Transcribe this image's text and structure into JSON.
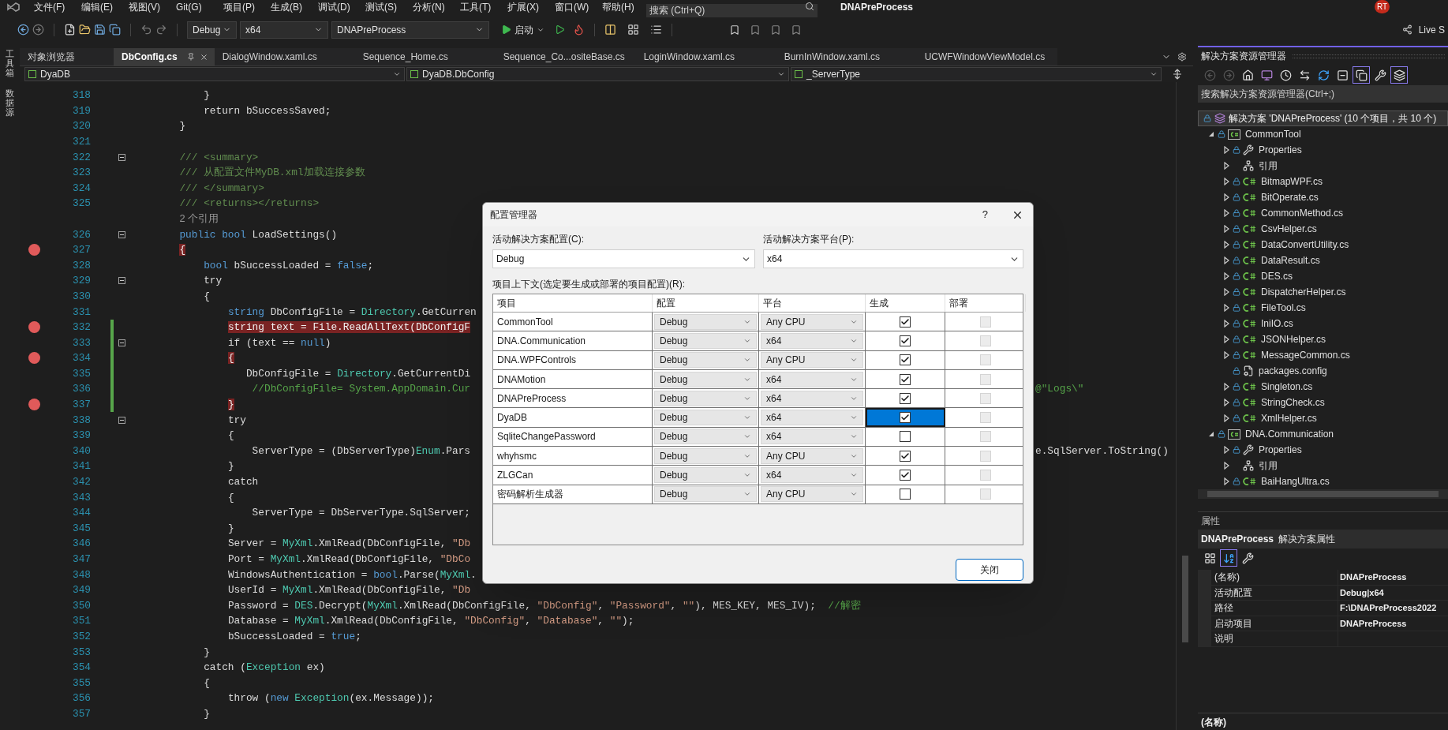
{
  "menu": [
    "文件(F)",
    "编辑(E)",
    "视图(V)",
    "Git(G)",
    "项目(P)",
    "生成(B)",
    "调试(D)",
    "测试(S)",
    "分析(N)",
    "工具(T)",
    "扩展(X)",
    "窗口(W)",
    "帮助(H)"
  ],
  "search": {
    "placeholder": "搜索 (Ctrl+Q)"
  },
  "window_title": "DNAPreProcess",
  "user_badge": "RT",
  "toolbar": {
    "configuration": "Debug",
    "platform": "x64",
    "startup_project": "DNAPreProcess",
    "start_button": "启动",
    "live_share": "Live S"
  },
  "side_strip": [
    "工具箱",
    "数据源"
  ],
  "tabs": [
    {
      "label": "对象浏览器",
      "selected": false
    },
    {
      "label": "DbConfig.cs",
      "selected": true
    },
    {
      "label": "DialogWindow.xaml.cs",
      "selected": false
    },
    {
      "label": "Sequence_Home.cs",
      "selected": false
    },
    {
      "label": "Sequence_Co...ositeBase.cs",
      "selected": false
    },
    {
      "label": "LoginWindow.xaml.cs",
      "selected": false
    },
    {
      "label": "BurnInWindow.xaml.cs",
      "selected": false
    },
    {
      "label": "UCWFWindowViewModel.cs",
      "selected": false
    }
  ],
  "navigation": {
    "project": "DyaDB",
    "type": "DyaDB.DbConfig",
    "member": "_ServerType"
  },
  "editor": {
    "lines": [
      {
        "number": "318",
        "breakpoint": false,
        "changed": false,
        "fold": false,
        "tokens": [
          {
            "kind": "plain",
            "text": "            }"
          }
        ]
      },
      {
        "number": "319",
        "breakpoint": false,
        "changed": false,
        "fold": false,
        "tokens": [
          {
            "kind": "plain",
            "text": "            return bSuccessSaved;"
          }
        ]
      },
      {
        "number": "320",
        "breakpoint": false,
        "changed": false,
        "fold": false,
        "tokens": [
          {
            "kind": "plain",
            "text": "        }"
          }
        ]
      },
      {
        "number": "321",
        "breakpoint": false,
        "changed": false,
        "fold": false
      },
      {
        "number": "322",
        "breakpoint": false,
        "changed": false,
        "fold": true,
        "tokens": [
          {
            "kind": "doc",
            "text": "        /// <summary>"
          }
        ]
      },
      {
        "number": "323",
        "breakpoint": false,
        "changed": false,
        "fold": false,
        "tokens": [
          {
            "kind": "doc",
            "text": "        /// 从配置文件MyDB.xml加载连接参数"
          }
        ]
      },
      {
        "number": "324",
        "breakpoint": false,
        "changed": false,
        "fold": false,
        "tokens": [
          {
            "kind": "doc",
            "text": "        /// </summary>"
          }
        ]
      },
      {
        "number": "325",
        "breakpoint": false,
        "changed": false,
        "fold": false,
        "tokens": [
          {
            "kind": "doc",
            "text": "        /// <returns></returns>"
          }
        ]
      },
      {
        "breakpoint": false,
        "changed": false,
        "fold": false,
        "tokens": [
          {
            "kind": "lens",
            "text": "        2 个引用"
          }
        ]
      },
      {
        "number": "326",
        "breakpoint": false,
        "changed": false,
        "fold": true,
        "tokens": [
          {
            "kind": "kw",
            "text": "        public bool"
          },
          {
            "kind": "plain",
            "text": " LoadSettings()"
          }
        ]
      },
      {
        "number": "327",
        "breakpoint": true,
        "changed": false,
        "fold": false,
        "tokens": [
          {
            "kind": "bp",
            "text": "        {"
          }
        ]
      },
      {
        "number": "328",
        "breakpoint": false,
        "changed": false,
        "fold": false,
        "tokens": [
          {
            "kind": "kw",
            "text": "            bool"
          },
          {
            "kind": "plain",
            "text": " bSuccessLoaded = "
          },
          {
            "kind": "kw",
            "text": "false"
          },
          {
            "kind": "plain",
            "text": ";"
          }
        ]
      },
      {
        "number": "329",
        "breakpoint": false,
        "changed": false,
        "fold": true,
        "tokens": [
          {
            "kind": "plain",
            "text": "            try"
          }
        ]
      },
      {
        "number": "330",
        "breakpoint": false,
        "changed": false,
        "fold": false,
        "tokens": [
          {
            "kind": "plain",
            "text": "            {"
          }
        ]
      },
      {
        "number": "331",
        "breakpoint": false,
        "changed": false,
        "fold": false,
        "tokens": [
          {
            "kind": "kw",
            "text": "                string"
          },
          {
            "kind": "plain",
            "text": " DbConfigFile = "
          },
          {
            "kind": "type",
            "text": "Directory"
          },
          {
            "kind": "plain",
            "text": ".GetCurren"
          }
        ]
      },
      {
        "number": "332",
        "breakpoint": true,
        "changed": true,
        "fold": false,
        "tokens": [
          {
            "kind": "bp",
            "text": "                string text = File.ReadAllText(DbConfigF"
          }
        ]
      },
      {
        "number": "333",
        "breakpoint": false,
        "changed": true,
        "fold": true,
        "tokens": [
          {
            "kind": "plain",
            "text": "                if (text == "
          },
          {
            "kind": "kw",
            "text": "null"
          },
          {
            "kind": "plain",
            "text": ")"
          }
        ]
      },
      {
        "number": "334",
        "breakpoint": true,
        "changed": true,
        "fold": false,
        "tokens": [
          {
            "kind": "bp",
            "text": "                {"
          }
        ]
      },
      {
        "number": "335",
        "breakpoint": false,
        "changed": true,
        "fold": false,
        "tokens": [
          {
            "kind": "plain",
            "text": "                   DbConfigFile = "
          },
          {
            "kind": "type",
            "text": "Directory"
          },
          {
            "kind": "plain",
            "text": ".GetCurrentDi"
          }
        ]
      },
      {
        "number": "336",
        "breakpoint": false,
        "changed": true,
        "fold": false,
        "tokens": [
          {
            "kind": "cmt",
            "text": "                    //DbConfigFile= System.AppDomain.Cur"
          }
        ],
        "right_tokens": [
          {
            "kind": "cmt",
            "text": "@\"Logs\\\""
          }
        ]
      },
      {
        "number": "337",
        "breakpoint": true,
        "changed": true,
        "fold": false,
        "tokens": [
          {
            "kind": "bp",
            "text": "                }"
          }
        ]
      },
      {
        "number": "338",
        "breakpoint": false,
        "changed": false,
        "fold": true,
        "tokens": [
          {
            "kind": "plain",
            "text": "                try"
          }
        ]
      },
      {
        "number": "339",
        "breakpoint": false,
        "changed": false,
        "fold": false,
        "tokens": [
          {
            "kind": "plain",
            "text": "                {"
          }
        ]
      },
      {
        "number": "340",
        "breakpoint": false,
        "changed": false,
        "fold": false,
        "tokens": [
          {
            "kind": "plain",
            "text": "                    ServerType = (DbServerType)"
          },
          {
            "kind": "type",
            "text": "Enum"
          },
          {
            "kind": "plain",
            "text": ".Pars"
          }
        ],
        "right_tokens": [
          {
            "kind": "plain",
            "text": "e.SqlServer.ToString()"
          }
        ]
      },
      {
        "number": "341",
        "breakpoint": false,
        "changed": false,
        "fold": false,
        "tokens": [
          {
            "kind": "plain",
            "text": "                }"
          }
        ]
      },
      {
        "number": "342",
        "breakpoint": false,
        "changed": false,
        "fold": false,
        "tokens": [
          {
            "kind": "plain",
            "text": "                catch"
          }
        ]
      },
      {
        "number": "343",
        "breakpoint": false,
        "changed": false,
        "fold": false,
        "tokens": [
          {
            "kind": "plain",
            "text": "                {"
          }
        ]
      },
      {
        "number": "344",
        "breakpoint": false,
        "changed": false,
        "fold": false,
        "tokens": [
          {
            "kind": "plain",
            "text": "                    ServerType = DbServerType.SqlServer;"
          }
        ]
      },
      {
        "number": "345",
        "breakpoint": false,
        "changed": false,
        "fold": false,
        "tokens": [
          {
            "kind": "plain",
            "text": "                }"
          }
        ]
      },
      {
        "number": "346",
        "breakpoint": false,
        "changed": false,
        "fold": false,
        "tokens": [
          {
            "kind": "plain",
            "text": "                Server = "
          },
          {
            "kind": "type",
            "text": "MyXml"
          },
          {
            "kind": "plain",
            "text": ".XmlRead(DbConfigFile, "
          },
          {
            "kind": "str",
            "text": "\"Db"
          }
        ]
      },
      {
        "number": "347",
        "breakpoint": false,
        "changed": false,
        "fold": false,
        "tokens": [
          {
            "kind": "plain",
            "text": "                Port = "
          },
          {
            "kind": "type",
            "text": "MyXml"
          },
          {
            "kind": "plain",
            "text": ".XmlRead(DbConfigFile, "
          },
          {
            "kind": "str",
            "text": "\"DbCo"
          }
        ]
      },
      {
        "number": "348",
        "breakpoint": false,
        "changed": false,
        "fold": false,
        "tokens": [
          {
            "kind": "plain",
            "text": "                WindowsAuthentication = "
          },
          {
            "kind": "kw",
            "text": "bool"
          },
          {
            "kind": "plain",
            "text": ".Parse("
          },
          {
            "kind": "type",
            "text": "MyXml"
          },
          {
            "kind": "plain",
            "text": "."
          }
        ]
      },
      {
        "number": "349",
        "breakpoint": false,
        "changed": false,
        "fold": false,
        "tokens": [
          {
            "kind": "plain",
            "text": "                UserId = "
          },
          {
            "kind": "type",
            "text": "MyXml"
          },
          {
            "kind": "plain",
            "text": ".XmlRead(DbConfigFile, "
          },
          {
            "kind": "str",
            "text": "\"Db"
          }
        ]
      },
      {
        "number": "350",
        "breakpoint": false,
        "changed": false,
        "fold": false,
        "tokens": [
          {
            "kind": "plain",
            "text": "                Password = "
          },
          {
            "kind": "type",
            "text": "DES"
          },
          {
            "kind": "plain",
            "text": ".Decrypt("
          },
          {
            "kind": "type",
            "text": "MyXml"
          },
          {
            "kind": "plain",
            "text": ".XmlRead(DbConfigFile, "
          },
          {
            "kind": "str",
            "text": "\"DbConfig\""
          },
          {
            "kind": "plain",
            "text": ", "
          },
          {
            "kind": "str",
            "text": "\"Password\""
          },
          {
            "kind": "plain",
            "text": ", "
          },
          {
            "kind": "str",
            "text": "\"\""
          },
          {
            "kind": "plain",
            "text": "), MES_KEY, MES_IV);  "
          },
          {
            "kind": "cmt",
            "text": "//解密"
          }
        ]
      },
      {
        "number": "351",
        "breakpoint": false,
        "changed": false,
        "fold": false,
        "tokens": [
          {
            "kind": "plain",
            "text": "                Database = "
          },
          {
            "kind": "type",
            "text": "MyXml"
          },
          {
            "kind": "plain",
            "text": ".XmlRead(DbConfigFile, "
          },
          {
            "kind": "str",
            "text": "\"DbConfig\""
          },
          {
            "kind": "plain",
            "text": ", "
          },
          {
            "kind": "str",
            "text": "\"Database\""
          },
          {
            "kind": "plain",
            "text": ", "
          },
          {
            "kind": "str",
            "text": "\"\""
          },
          {
            "kind": "plain",
            "text": ");"
          }
        ]
      },
      {
        "number": "352",
        "breakpoint": false,
        "changed": false,
        "fold": false,
        "tokens": [
          {
            "kind": "plain",
            "text": "                bSuccessLoaded = "
          },
          {
            "kind": "kw",
            "text": "true"
          },
          {
            "kind": "plain",
            "text": ";"
          }
        ]
      },
      {
        "number": "353",
        "breakpoint": false,
        "changed": false,
        "fold": false,
        "tokens": [
          {
            "kind": "plain",
            "text": "            }"
          }
        ]
      },
      {
        "number": "354",
        "breakpoint": false,
        "changed": false,
        "fold": false,
        "tokens": [
          {
            "kind": "plain",
            "text": "            catch ("
          },
          {
            "kind": "type",
            "text": "Exception"
          },
          {
            "kind": "plain",
            "text": " ex)"
          }
        ]
      },
      {
        "number": "355",
        "breakpoint": false,
        "changed": false,
        "fold": false,
        "tokens": [
          {
            "kind": "plain",
            "text": "            {"
          }
        ]
      },
      {
        "number": "356",
        "breakpoint": false,
        "changed": false,
        "fold": false,
        "tokens": [
          {
            "kind": "plain",
            "text": "                throw ("
          },
          {
            "kind": "kw",
            "text": "new "
          },
          {
            "kind": "type",
            "text": "Exception"
          },
          {
            "kind": "plain",
            "text": "(ex.Message));"
          }
        ]
      },
      {
        "number": "357",
        "breakpoint": false,
        "changed": false,
        "fold": false,
        "tokens": [
          {
            "kind": "plain",
            "text": "            }"
          }
        ]
      }
    ]
  },
  "dialog": {
    "title": "配置管理器",
    "help": "?",
    "config_label": "活动解决方案配置(C):",
    "config_value": "Debug",
    "platform_label": "活动解决方案平台(P):",
    "platform_value": "x64",
    "grid_label": "项目上下文(选定要生成或部署的项目配置)(R):",
    "columns": [
      "项目",
      "配置",
      "平台",
      "生成",
      "部署"
    ],
    "rows": [
      {
        "project": "CommonTool",
        "configuration": "Debug",
        "platform": "Any CPU",
        "build": true,
        "deploy": false,
        "deploy_disabled": true,
        "selected": false
      },
      {
        "project": "DNA.Communication",
        "configuration": "Debug",
        "platform": "x64",
        "build": true,
        "deploy": false,
        "deploy_disabled": true,
        "selected": false
      },
      {
        "project": "DNA.WPFControls",
        "configuration": "Debug",
        "platform": "Any CPU",
        "build": true,
        "deploy": false,
        "deploy_disabled": true,
        "selected": false
      },
      {
        "project": "DNAMotion",
        "configuration": "Debug",
        "platform": "x64",
        "build": true,
        "deploy": false,
        "deploy_disabled": true,
        "selected": false
      },
      {
        "project": "DNAPreProcess",
        "configuration": "Debug",
        "platform": "x64",
        "build": true,
        "deploy": false,
        "deploy_disabled": true,
        "selected": false
      },
      {
        "project": "DyaDB",
        "configuration": "Debug",
        "platform": "x64",
        "build": true,
        "deploy": false,
        "deploy_disabled": true,
        "selected": true
      },
      {
        "project": "SqliteChangePassword",
        "configuration": "Debug",
        "platform": "x64",
        "build": false,
        "deploy": false,
        "deploy_disabled": true,
        "selected": false
      },
      {
        "project": "whyhsmc",
        "configuration": "Debug",
        "platform": "Any CPU",
        "build": true,
        "deploy": false,
        "deploy_disabled": true,
        "selected": false
      },
      {
        "project": "ZLGCan",
        "configuration": "Debug",
        "platform": "x64",
        "build": true,
        "deploy": false,
        "deploy_disabled": true,
        "selected": false
      },
      {
        "project": "密码解析生成器",
        "configuration": "Debug",
        "platform": "Any CPU",
        "build": false,
        "deploy": false,
        "deploy_disabled": true,
        "selected": false
      }
    ],
    "close_button": "关闭"
  },
  "solution_explorer": {
    "title": "解决方案资源管理器",
    "toolbar": [
      {
        "kind": "back",
        "selected": false
      },
      {
        "kind": "forward",
        "selected": false
      },
      {
        "kind": "home",
        "selected": false
      },
      {
        "kind": "switch",
        "selected": false
      },
      {
        "kind": "history",
        "selected": false
      },
      {
        "kind": "sync",
        "selected": false
      },
      {
        "kind": "refresh",
        "selected": false
      },
      {
        "kind": "collapse",
        "selected": false
      },
      {
        "kind": "show_all",
        "selected": true
      },
      {
        "kind": "properties",
        "selected": false
      },
      {
        "kind": "preview",
        "selected": true
      }
    ],
    "search": {
      "placeholder": "搜索解决方案资源管理器(Ctrl+;)"
    },
    "solution": {
      "label": "解决方案 'DNAPreProcess' (10 个项目，共 10 个)",
      "locked": true
    },
    "projects": [
      {
        "label": "CommonTool",
        "kind": "project",
        "locked": true,
        "expanded": true,
        "children": [
          {
            "label": "Properties",
            "kind": "properties",
            "locked": true,
            "expanded": false
          },
          {
            "label": "引用",
            "kind": "references",
            "locked": false,
            "expanded": false
          },
          {
            "label": "BitmapWPF.cs",
            "kind": "code",
            "locked": true,
            "expanded": false
          },
          {
            "label": "BitOperate.cs",
            "kind": "code",
            "locked": true,
            "expanded": false
          },
          {
            "label": "CommonMethod.cs",
            "kind": "code",
            "locked": true,
            "expanded": false
          },
          {
            "label": "CsvHelper.cs",
            "kind": "code",
            "locked": true,
            "expanded": false
          },
          {
            "label": "DataConvertUtility.cs",
            "kind": "code",
            "locked": true,
            "expanded": false
          },
          {
            "label": "DataResult.cs",
            "kind": "code",
            "locked": true,
            "expanded": false
          },
          {
            "label": "DES.cs",
            "kind": "code",
            "locked": true,
            "expanded": false
          },
          {
            "label": "DispatcherHelper.cs",
            "kind": "code",
            "locked": true,
            "expanded": false
          },
          {
            "label": "FileTool.cs",
            "kind": "code",
            "locked": true,
            "expanded": false
          },
          {
            "label": "IniIO.cs",
            "kind": "code",
            "locked": true,
            "expanded": false
          },
          {
            "label": "JSONHelper.cs",
            "kind": "code",
            "locked": true,
            "expanded": false
          },
          {
            "label": "MessageCommon.cs",
            "kind": "code",
            "locked": true,
            "expanded": false
          },
          {
            "label": "packages.config",
            "kind": "config",
            "locked": true
          },
          {
            "label": "Singleton.cs",
            "kind": "code",
            "locked": true,
            "expanded": false
          },
          {
            "label": "StringCheck.cs",
            "kind": "code",
            "locked": true,
            "expanded": false
          },
          {
            "label": "XmlHelper.cs",
            "kind": "code",
            "locked": true,
            "expanded": false
          }
        ]
      },
      {
        "label": "DNA.Communication",
        "kind": "project",
        "locked": true,
        "expanded": true,
        "children": [
          {
            "label": "Properties",
            "kind": "properties",
            "locked": true,
            "expanded": false
          },
          {
            "label": "引用",
            "kind": "references",
            "locked": false,
            "expanded": false
          },
          {
            "label": "BaiHangUltra.cs",
            "kind": "code",
            "locked": true,
            "expanded": false
          }
        ]
      }
    ]
  },
  "properties": {
    "title": "属性",
    "object": "DNAPreProcess",
    "object_type": "解决方案属性",
    "toolbar": [
      {
        "kind": "categorized",
        "selected": false
      },
      {
        "kind": "alphabetical",
        "selected": true
      },
      {
        "kind": "pages",
        "selected": false
      }
    ],
    "rows": [
      {
        "name": "(名称)",
        "value": "DNAPreProcess"
      },
      {
        "name": "活动配置",
        "value": "Debug|x64"
      },
      {
        "name": "路径",
        "value": "F:\\DNAPreProcess2022"
      },
      {
        "name": "启动项目",
        "value": "DNAPreProcess"
      },
      {
        "name": "说明"
      }
    ],
    "description_title": "(名称)"
  }
}
